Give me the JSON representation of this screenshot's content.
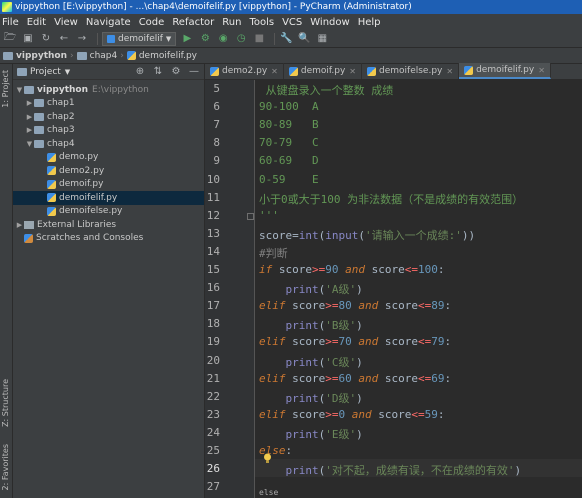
{
  "window": {
    "title": "vippython [E:\\vippython] - ...\\chap4\\demoifelif.py [vippython] - PyCharm (Administrator)"
  },
  "menu": [
    "File",
    "Edit",
    "View",
    "Navigate",
    "Code",
    "Refactor",
    "Run",
    "Tools",
    "VCS",
    "Window",
    "Help"
  ],
  "toolbar": {
    "run_config": "demoifelif",
    "icons": [
      "folder-open-icon",
      "save-icon",
      "sync-icon",
      "back-icon",
      "forward-icon",
      "run-icon",
      "debug-icon",
      "coverage-icon",
      "profile-icon",
      "stop-icon",
      "settings-icon",
      "search-icon",
      "structure-icon"
    ]
  },
  "breadcrumb": [
    "vippython",
    "chap4",
    "demoifelif.py"
  ],
  "project_panel": {
    "title": "Project",
    "tree": [
      {
        "label": "vippython",
        "path": "E:\\vippython",
        "level": 0,
        "expanded": true,
        "type": "folder"
      },
      {
        "label": "chap1",
        "level": 1,
        "expanded": false,
        "type": "folder"
      },
      {
        "label": "chap2",
        "level": 1,
        "expanded": false,
        "type": "folder"
      },
      {
        "label": "chap3",
        "level": 1,
        "expanded": false,
        "type": "folder"
      },
      {
        "label": "chap4",
        "level": 1,
        "expanded": true,
        "type": "folder"
      },
      {
        "label": "demo.py",
        "level": 2,
        "type": "file"
      },
      {
        "label": "demo2.py",
        "level": 2,
        "type": "file"
      },
      {
        "label": "demoif.py",
        "level": 2,
        "type": "file"
      },
      {
        "label": "demoifelif.py",
        "level": 2,
        "type": "file",
        "selected": true
      },
      {
        "label": "demoifelse.py",
        "level": 2,
        "type": "file"
      },
      {
        "label": "External Libraries",
        "level": 0,
        "expanded": false,
        "type": "lib"
      },
      {
        "label": "Scratches and Consoles",
        "level": 0,
        "type": "scratch"
      }
    ]
  },
  "side_strip": {
    "project": "1: Project",
    "structure": "Z: Structure",
    "favorites": "2: Favorites"
  },
  "tabs": [
    {
      "label": "demo2.py",
      "active": false
    },
    {
      "label": "demoif.py",
      "active": false
    },
    {
      "label": "demoifelse.py",
      "active": false
    },
    {
      "label": "demoifelif.py",
      "active": true
    }
  ],
  "editor": {
    "line_numbers": [
      "5",
      "6",
      "7",
      "8",
      "9",
      "10",
      "11",
      "12",
      "13",
      "14",
      "15",
      "16",
      "17",
      "18",
      "19",
      "20",
      "21",
      "22",
      "23",
      "24",
      "25",
      "26",
      "27"
    ],
    "lines": [
      [
        {
          "t": " 从键盘录入一个整数 成绩",
          "c": "doc"
        }
      ],
      [
        {
          "t": "90-100  A",
          "c": "doc"
        }
      ],
      [
        {
          "t": "80-89   B",
          "c": "doc"
        }
      ],
      [
        {
          "t": "70-79   C",
          "c": "doc"
        }
      ],
      [
        {
          "t": "60-69   D",
          "c": "doc"
        }
      ],
      [
        {
          "t": "0-59    E",
          "c": "doc"
        }
      ],
      [
        {
          "t": "小于0或大于100 为非法数据（不是成绩的有效范围）",
          "c": "doc"
        }
      ],
      [
        {
          "t": "'''",
          "c": "doc"
        }
      ],
      [
        {
          "t": "score",
          "c": "op"
        },
        {
          "t": "=",
          "c": "op"
        },
        {
          "t": "int",
          "c": "fn"
        },
        {
          "t": "(",
          "c": "op"
        },
        {
          "t": "input",
          "c": "fn"
        },
        {
          "t": "(",
          "c": "op"
        },
        {
          "t": "'请输入一个成绩:'",
          "c": "str"
        },
        {
          "t": "))",
          "c": "op"
        }
      ],
      [
        {
          "t": "#判断",
          "c": "com"
        }
      ],
      [
        {
          "t": "if ",
          "c": "kw"
        },
        {
          "t": "score",
          "c": "op"
        },
        {
          "t": ">=",
          "c": "err"
        },
        {
          "t": "90 ",
          "c": "num"
        },
        {
          "t": "and ",
          "c": "kw"
        },
        {
          "t": "score",
          "c": "op"
        },
        {
          "t": "<=",
          "c": "err"
        },
        {
          "t": "100",
          "c": "num"
        },
        {
          "t": ":",
          "c": "op"
        }
      ],
      [
        {
          "t": "    print",
          "c": "fn"
        },
        {
          "t": "(",
          "c": "op"
        },
        {
          "t": "'A级'",
          "c": "str"
        },
        {
          "t": ")",
          "c": "op"
        }
      ],
      [
        {
          "t": "elif ",
          "c": "kw"
        },
        {
          "t": "score",
          "c": "op"
        },
        {
          "t": ">=",
          "c": "err"
        },
        {
          "t": "80 ",
          "c": "num"
        },
        {
          "t": "and ",
          "c": "kw"
        },
        {
          "t": "score",
          "c": "op"
        },
        {
          "t": "<=",
          "c": "err"
        },
        {
          "t": "89",
          "c": "num"
        },
        {
          "t": ":",
          "c": "op"
        }
      ],
      [
        {
          "t": "    print",
          "c": "fn"
        },
        {
          "t": "(",
          "c": "op"
        },
        {
          "t": "'B级'",
          "c": "str"
        },
        {
          "t": ")",
          "c": "op"
        }
      ],
      [
        {
          "t": "elif ",
          "c": "kw"
        },
        {
          "t": "score",
          "c": "op"
        },
        {
          "t": ">=",
          "c": "err"
        },
        {
          "t": "70 ",
          "c": "num"
        },
        {
          "t": "and ",
          "c": "kw"
        },
        {
          "t": "score",
          "c": "op"
        },
        {
          "t": "<=",
          "c": "err"
        },
        {
          "t": "79",
          "c": "num"
        },
        {
          "t": ":",
          "c": "op"
        }
      ],
      [
        {
          "t": "    print",
          "c": "fn"
        },
        {
          "t": "(",
          "c": "op"
        },
        {
          "t": "'C级'",
          "c": "str"
        },
        {
          "t": ")",
          "c": "op"
        }
      ],
      [
        {
          "t": "elif ",
          "c": "kw"
        },
        {
          "t": "score",
          "c": "op"
        },
        {
          "t": ">=",
          "c": "err"
        },
        {
          "t": "60 ",
          "c": "num"
        },
        {
          "t": "and ",
          "c": "kw"
        },
        {
          "t": "score",
          "c": "op"
        },
        {
          "t": "<=",
          "c": "err"
        },
        {
          "t": "69",
          "c": "num"
        },
        {
          "t": ":",
          "c": "op"
        }
      ],
      [
        {
          "t": "    print",
          "c": "fn"
        },
        {
          "t": "(",
          "c": "op"
        },
        {
          "t": "'D级'",
          "c": "str"
        },
        {
          "t": ")",
          "c": "op"
        }
      ],
      [
        {
          "t": "elif ",
          "c": "kw"
        },
        {
          "t": "score",
          "c": "op"
        },
        {
          "t": ">=",
          "c": "err"
        },
        {
          "t": "0 ",
          "c": "num"
        },
        {
          "t": "and ",
          "c": "kw"
        },
        {
          "t": "score",
          "c": "op"
        },
        {
          "t": "<=",
          "c": "err"
        },
        {
          "t": "59",
          "c": "num"
        },
        {
          "t": ":",
          "c": "op"
        }
      ],
      [
        {
          "t": "    print",
          "c": "fn"
        },
        {
          "t": "(",
          "c": "op"
        },
        {
          "t": "'E级'",
          "c": "str"
        },
        {
          "t": ")",
          "c": "op"
        }
      ],
      [
        {
          "t": "else",
          "c": "kw"
        },
        {
          "t": ":",
          "c": "op"
        }
      ],
      [
        {
          "t": "    print",
          "c": "fn"
        },
        {
          "t": "(",
          "c": "op"
        },
        {
          "t": "'对不起，成绩有误，不在成绩的有效'",
          "c": "str"
        },
        {
          "t": ")",
          "c": "op"
        }
      ],
      []
    ],
    "current_line": "26",
    "hint": "else"
  },
  "colors": {
    "titlebar": "#1e5fb4",
    "editor_bg": "#2b2b2b",
    "keyword": "#cc7832",
    "string": "#6a8759",
    "number": "#6897bb",
    "builtin": "#8888c6"
  }
}
